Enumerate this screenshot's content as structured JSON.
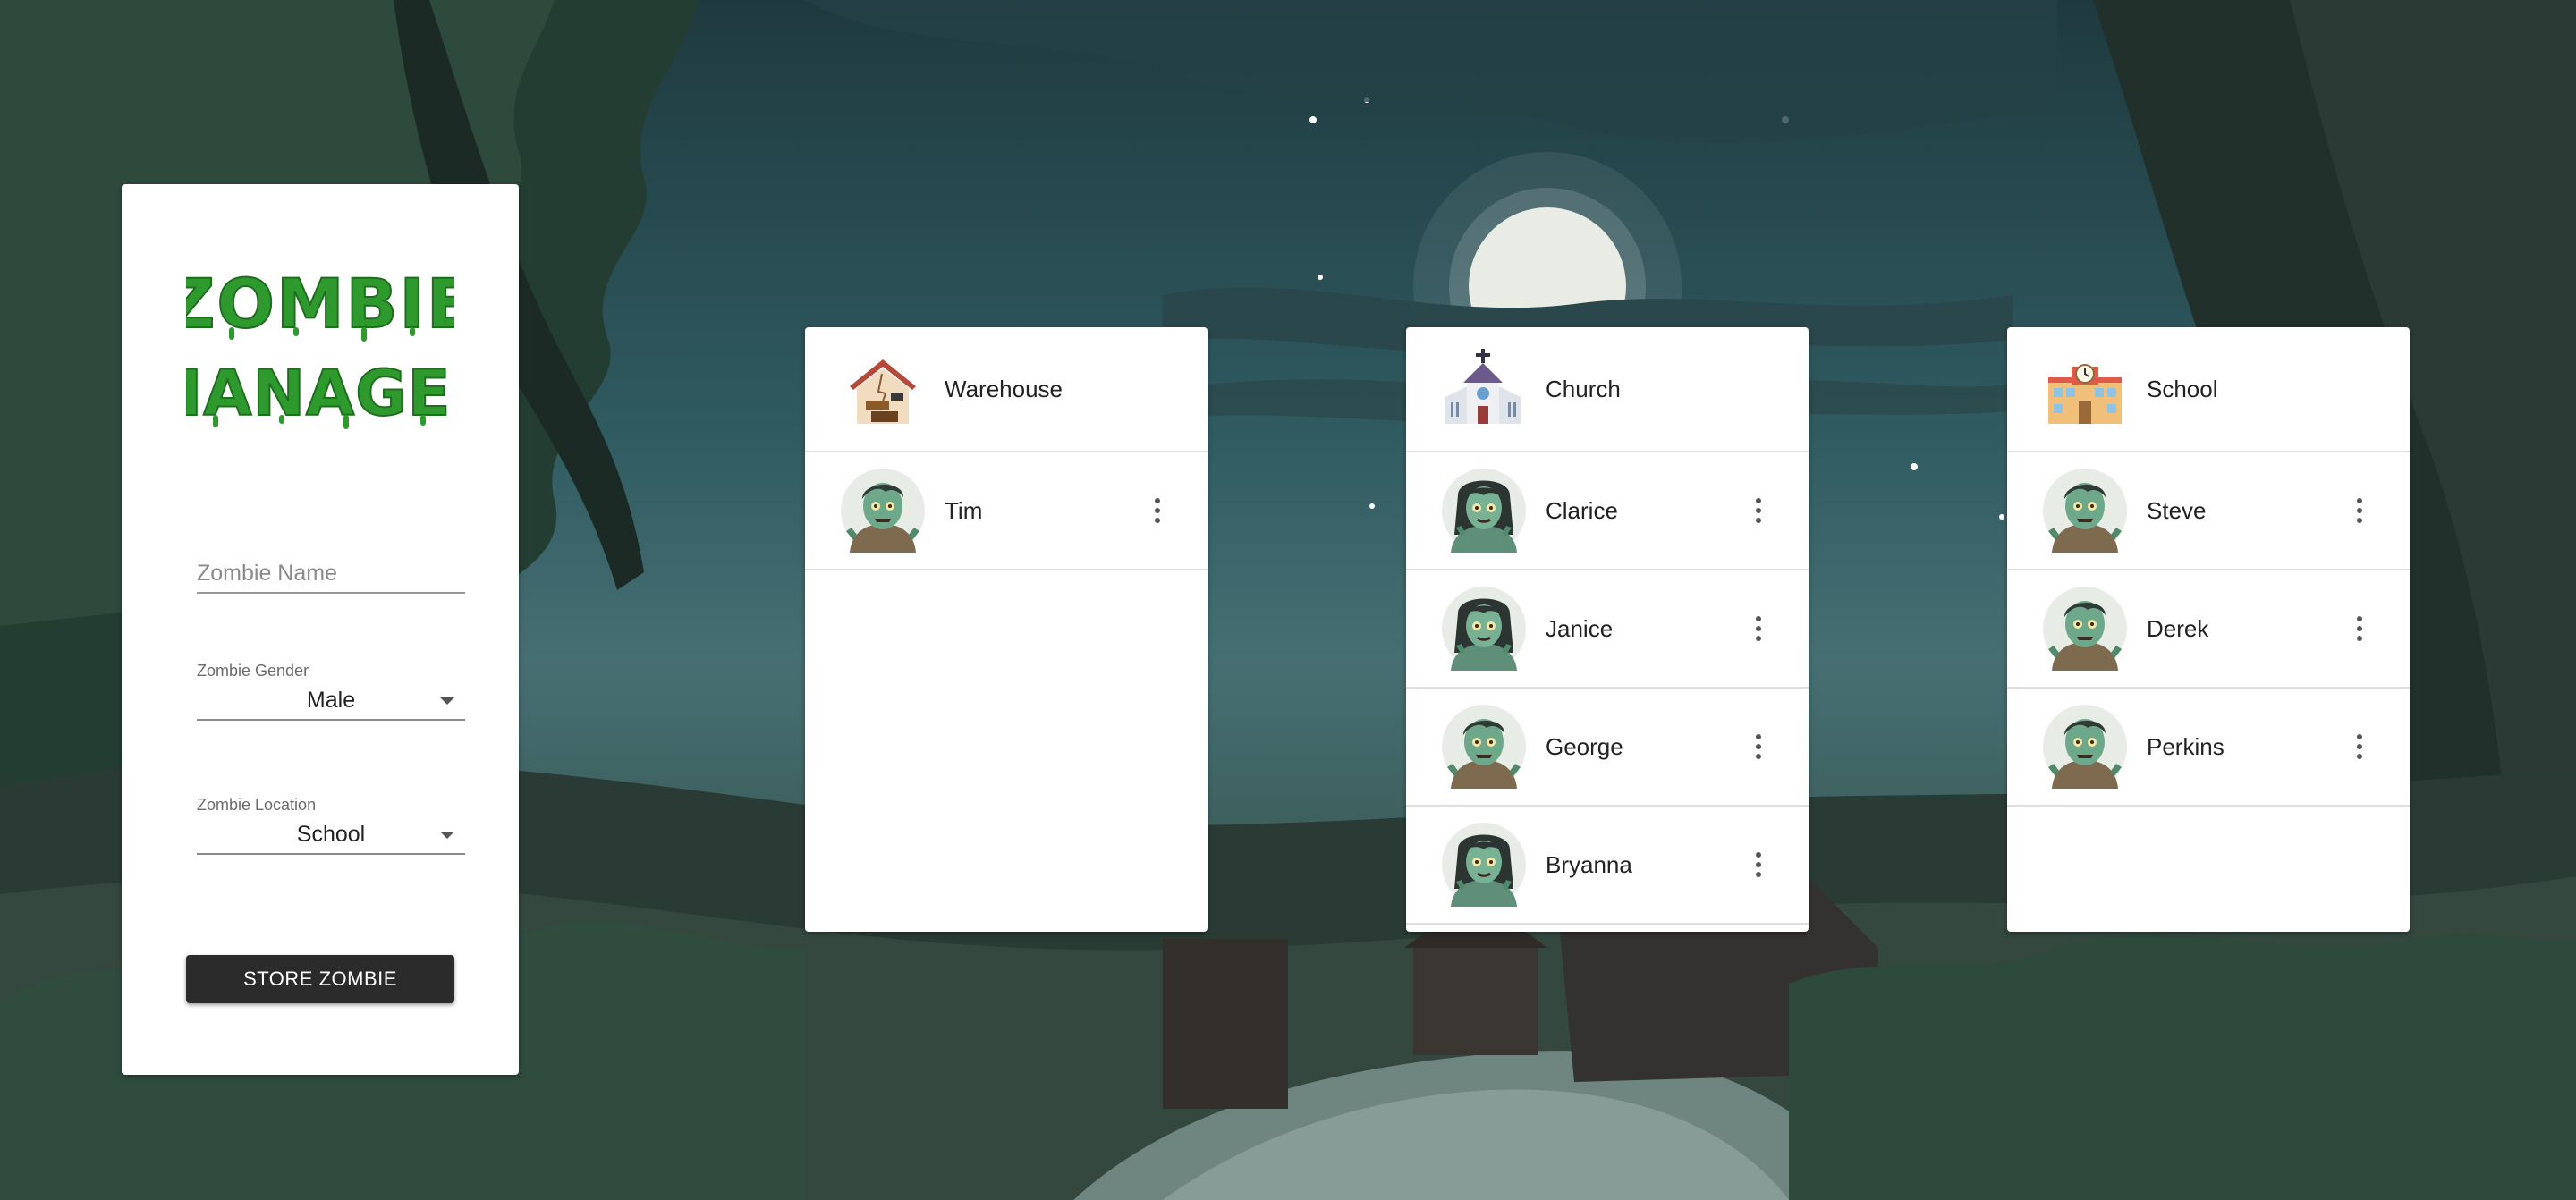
{
  "app": {
    "logo_text": "ZOMBIE MANAGER",
    "logo_color": "#2e9a2e"
  },
  "form": {
    "name_placeholder": "Zombie Name",
    "gender_label": "Zombie Gender",
    "gender_value": "Male",
    "location_label": "Zombie Location",
    "location_value": "School",
    "store_button": "STORE ZOMBIE"
  },
  "locations": [
    {
      "name": "Warehouse",
      "icon": "warehouse-icon",
      "zombies": [
        {
          "name": "Tim",
          "gender": "male"
        }
      ]
    },
    {
      "name": "Church",
      "icon": "church-icon",
      "zombies": [
        {
          "name": "Clarice",
          "gender": "female"
        },
        {
          "name": "Janice",
          "gender": "female"
        },
        {
          "name": "George",
          "gender": "male"
        },
        {
          "name": "Bryanna",
          "gender": "female"
        }
      ]
    },
    {
      "name": "School",
      "icon": "school-icon",
      "zombies": [
        {
          "name": "Steve",
          "gender": "male"
        },
        {
          "name": "Derek",
          "gender": "male"
        },
        {
          "name": "Perkins",
          "gender": "male"
        }
      ]
    }
  ]
}
